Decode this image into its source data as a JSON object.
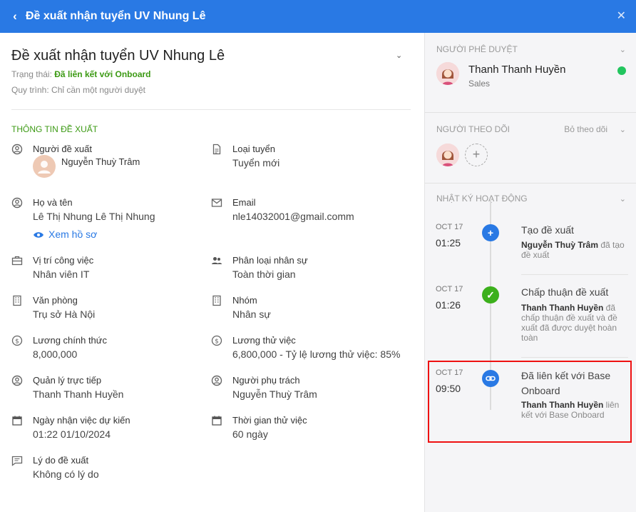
{
  "header": {
    "back_icon": "chevron-left-icon",
    "title": "Đề xuất nhận tuyển UV Nhung Lê",
    "close_icon": "close-icon"
  },
  "main": {
    "title": "Đề xuất nhận tuyển UV Nhung Lê",
    "status_label": "Trạng thái: ",
    "status_value": "Đã liên kết với Onboard",
    "workflow": "Quy trình: Chỉ cần một người duyệt",
    "section_title": "THÔNG TIN ĐỀ XUẤT",
    "status_color": "#3c9a14",
    "fields": {
      "proposer": {
        "label": "Người đề xuất",
        "value": "Nguyễn Thuỳ Trâm",
        "icon": "user-circle-icon"
      },
      "hire_type": {
        "label": "Loại tuyển",
        "value": "Tuyển mới",
        "icon": "document-icon"
      },
      "full_name": {
        "label": "Họ và tên",
        "value": "Lê Thị Nhung Lê Thị Nhung",
        "link": "Xem hồ sơ",
        "icon": "user-circle-icon"
      },
      "email": {
        "label": "Email",
        "value": "nle14032001@gmail.comm",
        "icon": "mail-icon"
      },
      "position": {
        "label": "Vị trí công việc",
        "value": "Nhân viên IT",
        "icon": "briefcase-icon"
      },
      "staff_type": {
        "label": "Phân loại nhân sự",
        "value": "Toàn thời gian",
        "icon": "users-icon"
      },
      "office": {
        "label": "Văn phòng",
        "value": "Trụ sở Hà Nội",
        "icon": "building-icon"
      },
      "group": {
        "label": "Nhóm",
        "value": "Nhân sự",
        "icon": "building-icon"
      },
      "salary": {
        "label": "Lương chính thức",
        "value": "8,000,000",
        "icon": "dollar-icon"
      },
      "probation_salary": {
        "label": "Lương thử việc",
        "value": "6,800,000 - Tỷ lệ lương thử việc: 85%",
        "icon": "dollar-icon"
      },
      "manager": {
        "label": "Quản lý trực tiếp",
        "value": "Thanh Thanh Huyền",
        "icon": "user-circle-icon"
      },
      "owner": {
        "label": "Người phụ trách",
        "value": "Nguyễn Thuỳ Trâm",
        "icon": "user-circle-icon"
      },
      "start_date": {
        "label": "Ngày nhận việc dự kiến",
        "value": "01:22 01/10/2024",
        "icon": "calendar-icon"
      },
      "probation_time": {
        "label": "Thời gian thử việc",
        "value": "60 ngày",
        "icon": "calendar-icon"
      },
      "reason": {
        "label": "Lý do đề xuất",
        "value": "Không có lý do",
        "icon": "comment-icon"
      }
    }
  },
  "sidebar": {
    "approvers": {
      "title": "NGƯỜI PHÊ DUYỆT",
      "name": "Thanh Thanh Huyền",
      "role": "Sales",
      "online_color": "#22c55e"
    },
    "followers": {
      "title": "NGƯỜI THEO DÕI",
      "unfollow": "Bỏ theo dõi",
      "add_icon": "plus-icon"
    },
    "activity": {
      "title": "NHẬT KÝ HOẠT ĐỘNG",
      "items": [
        {
          "date": "OCT 17",
          "time": "01:25",
          "title": "Tạo đề xuất",
          "actor": "Nguyễn Thuỳ Trâm",
          "action": " đã tạo đề xuất",
          "icon": "plus-icon",
          "color": "#2979e4"
        },
        {
          "date": "OCT 17",
          "time": "01:26",
          "title": "Chấp thuận đề xuất",
          "actor": "Thanh Thanh Huyền",
          "action": " đã chấp thuận đề xuất và đề xuất đã được duyệt hoàn toàn",
          "icon": "check-icon",
          "color": "#3cb01c"
        },
        {
          "date": "OCT 17",
          "time": "09:50",
          "title": "Đã liên kết với Base Onboard",
          "actor": "Thanh Thanh Huyền",
          "action": " liên kết với Base Onboard",
          "icon": "link-icon",
          "color": "#2979e4"
        }
      ]
    }
  }
}
